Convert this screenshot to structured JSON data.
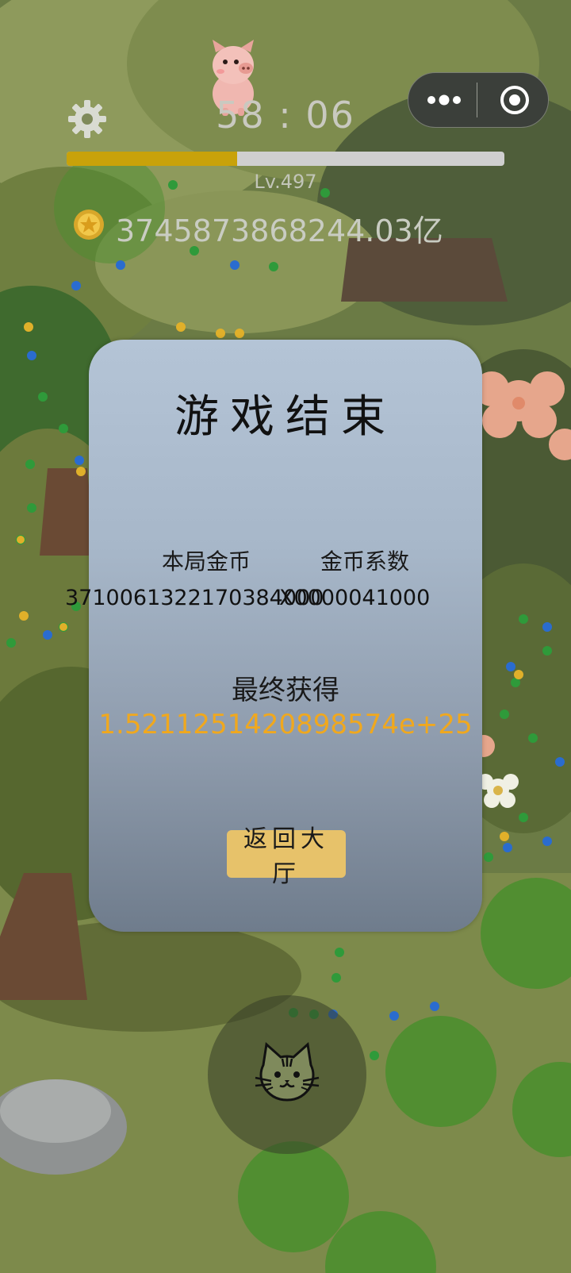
{
  "hud": {
    "timer": "58 : 06",
    "level": "Lv.497",
    "progress_fraction": 0.39,
    "coin_total": "3745873868244.03亿"
  },
  "icons": {
    "settings": "gear-icon",
    "coin": "coin-icon",
    "pig": "pig-icon",
    "more": "more-dots-icon",
    "close": "target-circle-icon",
    "joystick": "cat-face-icon"
  },
  "dialog": {
    "title": "游戏结束",
    "round_coins_label": "本局金币",
    "coin_multiplier_label": "金币系数",
    "round_coins_value": "3710061322170384000",
    "coin_multiplier_value": "X0000041000",
    "final_label": "最终获得",
    "final_value": "1.5211251420898574e+25",
    "back_button_label": "返回大厅"
  },
  "colors": {
    "accent_gold": "#f0a81e",
    "progress_fill": "#c8a20a",
    "button_bg": "#e7c26a",
    "dialog_top": "#b4c4d6",
    "dialog_bottom": "#6f7c8c"
  }
}
